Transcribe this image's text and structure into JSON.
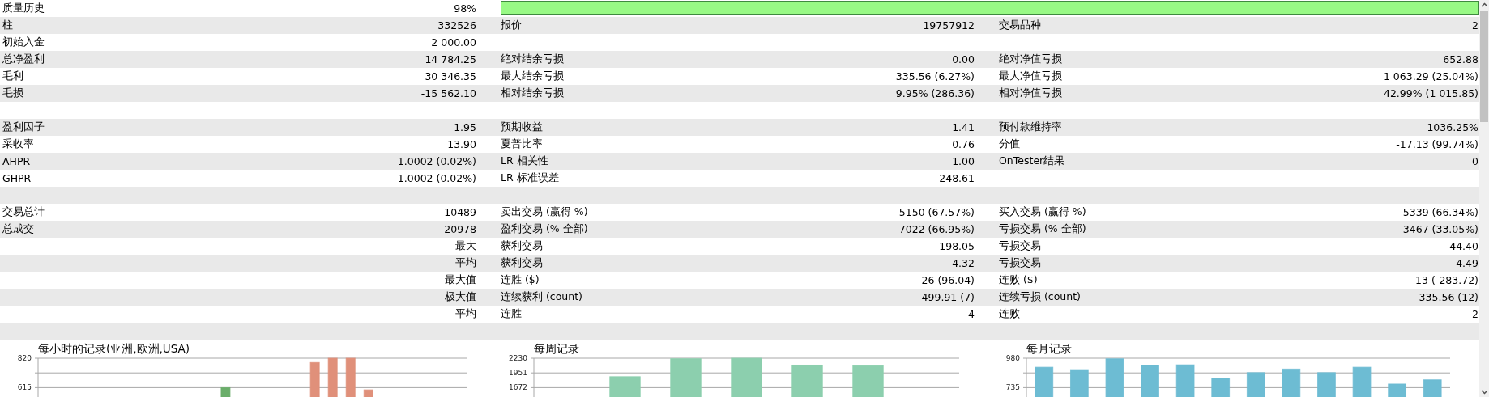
{
  "report": {
    "rows": [
      {
        "col_1": {
          "label": "质量历史",
          "value": "98%"
        },
        "quality_bar": {
          "level": 1
        }
      },
      {
        "col_1": {
          "label": "柱",
          "value": "332526"
        },
        "col_2": {
          "label": "报价",
          "value": "19757912"
        },
        "col_3": {
          "label": "交易品种",
          "value": "2"
        }
      },
      {
        "col_1": {
          "label": "初始入金",
          "value": "2 000.00"
        }
      },
      {
        "col_1": {
          "label": "总净盈利",
          "value": "14 784.25"
        },
        "col_2": {
          "label": "绝对结余亏损",
          "value": "0.00"
        },
        "col_3": {
          "label": "绝对净值亏损",
          "value": "652.88"
        }
      },
      {
        "col_1": {
          "label": "毛利",
          "value": "30 346.35"
        },
        "col_2": {
          "label": "最大结余亏损",
          "value": "335.56 (6.27%)"
        },
        "col_3": {
          "label": "最大净值亏损",
          "value": "1 063.29 (25.04%)"
        }
      },
      {
        "col_1": {
          "label": "毛损",
          "value": "-15 562.10"
        },
        "col_2": {
          "label": "相对结余亏损",
          "value": "9.95% (286.36)"
        },
        "col_3": {
          "label": "相对净值亏损",
          "value": "42.99% (1 015.85)"
        }
      },
      {},
      {
        "col_1": {
          "label": "盈利因子",
          "value": "1.95"
        },
        "col_2": {
          "label": "预期收益",
          "value": "1.41"
        },
        "col_3": {
          "label": "预付款维持率",
          "value": "1036.25%"
        }
      },
      {
        "col_1": {
          "label": "采收率",
          "value": "13.90"
        },
        "col_2": {
          "label": "夏普比率",
          "value": "0.76"
        },
        "col_3": {
          "label": "分值",
          "value": "-17.13 (99.74%)"
        }
      },
      {
        "col_1": {
          "label": "AHPR",
          "value": "1.0002 (0.02%)"
        },
        "col_2": {
          "label": "LR 相关性",
          "value": "1.00"
        },
        "col_3": {
          "label": "OnTester结果",
          "value": "0"
        }
      },
      {
        "col_1": {
          "label": "GHPR",
          "value": "1.0002 (0.02%)"
        },
        "col_2": {
          "label": "LR 标准误差",
          "value": "248.61"
        }
      },
      {},
      {
        "col_1": {
          "label": "交易总计",
          "value": "10489"
        },
        "col_2": {
          "label": "卖出交易 (赢得 %)",
          "value": "5150 (67.57%)"
        },
        "col_3": {
          "label": "买入交易 (赢得 %)",
          "value": "5339 (66.34%)"
        }
      },
      {
        "col_1": {
          "label": "总成交",
          "value": "20978"
        },
        "col_2": {
          "label": "盈利交易 (% 全部)",
          "value": "7022 (66.95%)"
        },
        "col_3": {
          "label": "亏损交易 (% 全部)",
          "value": "3467 (33.05%)"
        }
      },
      {
        "col_1": {
          "value": "最大"
        },
        "col_2": {
          "label": "获利交易",
          "value": "198.05"
        },
        "col_3": {
          "label": "亏损交易",
          "value": "-44.40"
        }
      },
      {
        "col_1": {
          "value": "平均"
        },
        "col_2": {
          "label": "获利交易",
          "value": "4.32"
        },
        "col_3": {
          "label": "亏损交易",
          "value": "-4.49"
        }
      },
      {
        "col_1": {
          "value": "最大值"
        },
        "col_2": {
          "label": "连胜 ($)",
          "value": "26 (96.04)"
        },
        "col_3": {
          "label": "连败 ($)",
          "value": "13 (-283.72)"
        }
      },
      {
        "col_1": {
          "value": "极大值"
        },
        "col_2": {
          "label": "连续获利 (count)",
          "value": "499.91 (7)"
        },
        "col_3": {
          "label": "连续亏损 (count)",
          "value": "-335.56 (12)"
        }
      },
      {
        "col_1": {
          "value": "平均"
        },
        "col_2": {
          "label": "连胜",
          "value": "4"
        },
        "col_3": {
          "label": "连败",
          "value": "2"
        }
      },
      {}
    ]
  },
  "charts": [
    {
      "chart_data": {
        "type": "bar",
        "title": "每小时的记录(亚洲,欧洲,USA)",
        "ylim": [
          550,
          820
        ],
        "yticks": [
          615,
          820
        ],
        "series": [
          {
            "color": "#6aae6a",
            "values": [
              null,
              null,
              null,
              null,
              null,
              null,
              null,
              null,
              null,
              null,
              615,
              null,
              null,
              null,
              null,
              null,
              null,
              null,
              null,
              null,
              null,
              null,
              null,
              null
            ]
          },
          {
            "color": "#e0907a",
            "values": [
              null,
              null,
              null,
              null,
              null,
              null,
              null,
              null,
              null,
              null,
              null,
              null,
              null,
              null,
              null,
              790,
              820,
              820,
              600,
              null,
              null,
              null,
              null,
              null
            ]
          }
        ]
      }
    },
    {
      "chart_data": {
        "type": "bar",
        "title": "每周记录",
        "ylim": [
          1494,
          2230
        ],
        "yticks": [
          1672,
          1951,
          2230
        ],
        "series": [
          {
            "color": "#8ccfae",
            "values": [
              null,
              1880,
              2220,
              2230,
              2100,
              2090,
              null
            ]
          }
        ]
      }
    },
    {
      "chart_data": {
        "type": "bar",
        "title": "每月记录",
        "ylim": [
          657,
          980
        ],
        "yticks": [
          735,
          980
        ],
        "series": [
          {
            "color": "#6dbcd3",
            "values": [
              905,
              885,
              975,
              920,
              925,
              815,
              860,
              890,
              860,
              905,
              765,
              800
            ]
          }
        ]
      }
    }
  ]
}
